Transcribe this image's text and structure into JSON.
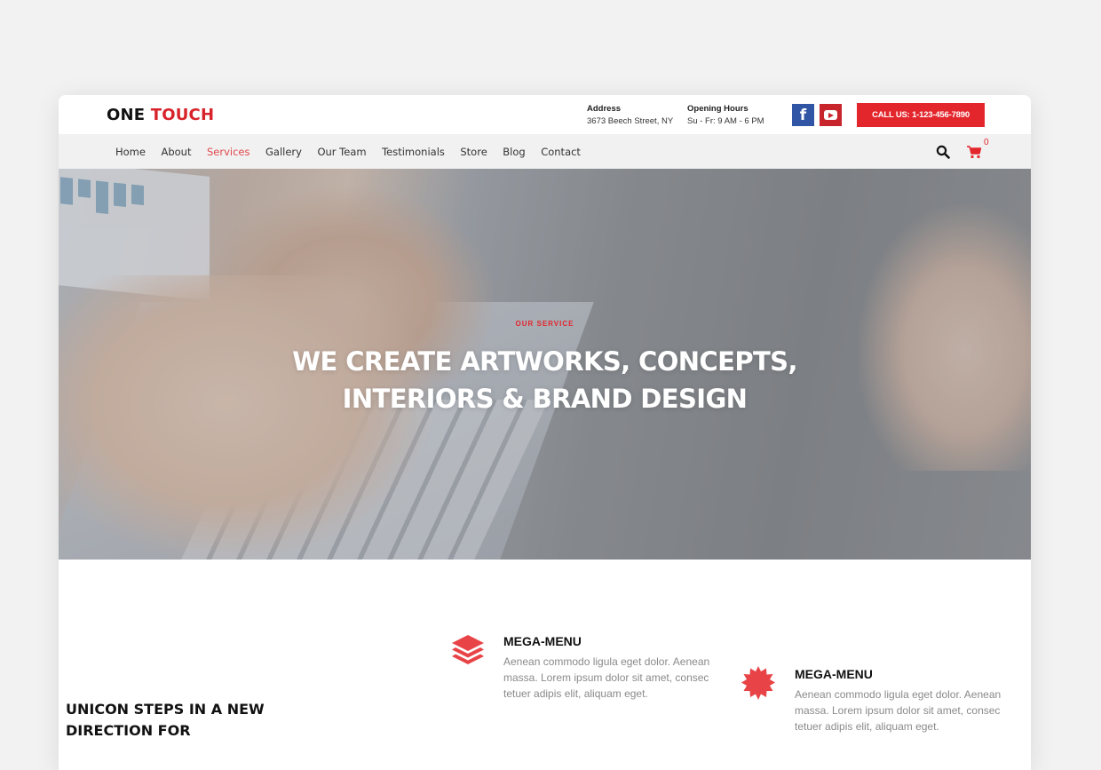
{
  "brand": {
    "name_part1": "ONE",
    "name_part2": "TOUCH",
    "accent_color": "#e3262c"
  },
  "header": {
    "address": {
      "title": "Address",
      "value": "3673 Beech Street, NY"
    },
    "hours": {
      "title": "Opening Hours",
      "value": "Su - Fr: 9 AM - 6 PM"
    },
    "social": [
      {
        "name": "facebook",
        "glyph": "f"
      },
      {
        "name": "youtube",
        "glyph": "play"
      }
    ],
    "call_button": "CALL US: 1-123-456-7890"
  },
  "nav": {
    "items": [
      {
        "label": "Home",
        "active": false
      },
      {
        "label": "About",
        "active": false
      },
      {
        "label": "Services",
        "active": true
      },
      {
        "label": "Gallery",
        "active": false
      },
      {
        "label": "Our Team",
        "active": false
      },
      {
        "label": "Testimonials",
        "active": false
      },
      {
        "label": "Store",
        "active": false
      },
      {
        "label": "Blog",
        "active": false
      },
      {
        "label": "Contact",
        "active": false
      }
    ],
    "search_icon": "search-icon",
    "cart_icon": "cart-icon",
    "cart_count": "0"
  },
  "hero": {
    "eyebrow": "OUR SERVICE",
    "title_line1": "WE CREATE ARTWORKS, CONCEPTS,",
    "title_line2": "INTERIORS & BRAND DESIGN"
  },
  "features": [
    {
      "icon": "layers-icon",
      "title": "MEGA-MENU",
      "text": "Aenean commodo ligula eget dolor. Aenean massa. Lorem ipsum dolor sit amet, consec tetuer adipis elit, aliquam eget."
    },
    {
      "icon": "badge-icon",
      "title": "MEGA-MENU",
      "text": "Aenean commodo ligula eget dolor. Aenean massa. Lorem ipsum dolor sit amet, consec tetuer adipis elit, aliquam eget."
    }
  ],
  "section": {
    "heading": "UNICON STEPS IN A NEW DIRECTION FOR"
  }
}
